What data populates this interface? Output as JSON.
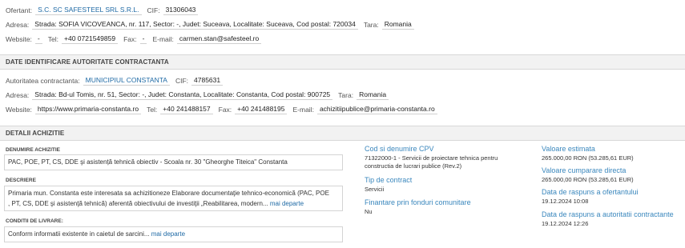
{
  "ofertant": {
    "label": "Ofertant:",
    "name": "S.C. SC SAFESTEEL SRL S.R.L.",
    "cif_label": "CIF:",
    "cif": "31306043",
    "adresa_label": "Adresa:",
    "adresa": "Strada: SOFIA VICOVEANCA, nr. 117, Sector: -, Judet: Suceava, Localitate: Suceava, Cod postal: 720034",
    "tara_label": "Tara:",
    "tara": "Romania",
    "website_label": "Website:",
    "website": "-",
    "tel_label": "Tel:",
    "tel": "+40 0721549859",
    "fax_label": "Fax:",
    "fax": "-",
    "email_label": "E-mail:",
    "email": "carmen.stan@safesteel.ro"
  },
  "autoritate": {
    "section_title": "DATE IDENTIFICARE AUTORITATE CONTRACTANTA",
    "label": "Autoritatea contractanta:",
    "name": "MUNICIPIUL CONSTANTA",
    "cif_label": "CIF:",
    "cif": "4785631",
    "adresa_label": "Adresa:",
    "adresa": "Strada: Bd-ul Tomis, nr. 51, Sector: -, Judet: Constanta, Localitate: Constanta, Cod postal: 900725",
    "tara_label": "Tara:",
    "tara": "Romania",
    "website_label": "Website:",
    "website": "https://www.primaria-constanta.ro",
    "tel_label": "Tel:",
    "tel": "+40 241488157",
    "fax_label": "Fax:",
    "fax": "+40 241488195",
    "email_label": "E-mail:",
    "email": "achizitiipublice@primaria-constanta.ro"
  },
  "detalii": {
    "section_title": "DETALII ACHIZITIE",
    "denumire_label": "DENUMIRE ACHIZITIE",
    "denumire": "PAC, POE, PT, CS, DDE şi asistență tehnică obiectiv - Scoala nr. 30 \"Gheorghe Titeica\" Constanta",
    "descriere_label": "DESCRIERE",
    "descriere_line1": "Primaria mun. Constanta este interesata sa achizitioneze Elaborare documentaţie tehnico-economică (PAC, POE",
    "descriere_line2": ", PT, CS, DDE şi asistenţă tehnică) aferentă obiectivului de investiţii „Reabilitarea, modern...",
    "descriere_more": "mai departe",
    "conditii_label": "CONDITII DE LIVRARE:",
    "conditii": "Conform informatii existente in caietul de sarcini...",
    "conditii_more": "mai departe",
    "cpv_title": "Cod si denumire CPV",
    "cpv_line1": "71322000-1 - Servicii de proiectare tehnica pentru",
    "cpv_line2": "constructia de lucrari publice (Rev.2)",
    "tip_title": "Tip de contract",
    "tip": "Servicii",
    "fonduri_title": "Finantare prin fonduri comunitare",
    "fonduri": "Nu",
    "valoare_title": "Valoare estimata",
    "valoare": "265.000,00  RON (53.285,61  EUR)",
    "cumparare_title": "Valoare cumparare directa",
    "cumparare": "265.000,00  RON (53.285,61  EUR)",
    "raspuns_ofertant_title": "Data de raspuns a ofertantului",
    "raspuns_ofertant": "19.12.2024 10:08",
    "raspuns_autoritate_title": "Data de raspuns a autoritatii contractante",
    "raspuns_autoritate": "19.12.2024 12:26"
  }
}
